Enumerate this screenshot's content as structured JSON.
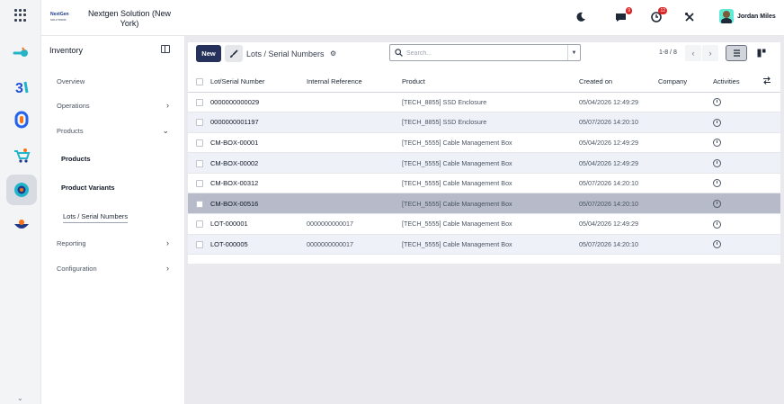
{
  "company": {
    "logo_text": "NextGen",
    "logo_sub": "SOLUTIONS",
    "name": "Nextgen Solution (New York)"
  },
  "header": {
    "chat_badge": "9",
    "activity_badge": "12",
    "user_name": "Jordan Miles"
  },
  "sidebar": {
    "title": "Inventory",
    "items": [
      {
        "label": "Overview"
      },
      {
        "label": "Operations"
      },
      {
        "label": "Products"
      },
      {
        "label": "Reporting"
      },
      {
        "label": "Configuration"
      }
    ],
    "sub_items": [
      {
        "label": "Products"
      },
      {
        "label": "Product Variants"
      },
      {
        "label": "Lots / Serial Numbers"
      }
    ]
  },
  "controls": {
    "new_label": "New",
    "breadcrumb": "Lots / Serial Numbers",
    "search_placeholder": "Search...",
    "pager": "1-8 / 8"
  },
  "table": {
    "headers": [
      "Lot/Serial Number",
      "Internal Reference",
      "Product",
      "Created on",
      "Company",
      "Activities"
    ],
    "rows": [
      {
        "serial": "0000000000029",
        "ref": "",
        "product": "[TECH_8855] SSD Enclosure",
        "created": "05/04/2026 12:49:29",
        "company": ""
      },
      {
        "serial": "0000000001197",
        "ref": "",
        "product": "[TECH_8855] SSD Enclosure",
        "created": "05/07/2026 14:20:10",
        "company": ""
      },
      {
        "serial": "CM-BOX-00001",
        "ref": "",
        "product": "[TECH_5555] Cable Management Box",
        "created": "05/04/2026 12:49:29",
        "company": ""
      },
      {
        "serial": "CM-BOX-00002",
        "ref": "",
        "product": "[TECH_5555] Cable Management Box",
        "created": "05/04/2026 12:49:29",
        "company": ""
      },
      {
        "serial": "CM-BOX-00312",
        "ref": "",
        "product": "[TECH_5555] Cable Management Box",
        "created": "05/07/2026 14:20:10",
        "company": ""
      },
      {
        "serial": "CM-BOX-00516",
        "ref": "",
        "product": "[TECH_5555] Cable Management Box",
        "created": "05/07/2026 14:20:10",
        "company": ""
      },
      {
        "serial": "LOT-000001",
        "ref": "0000000000017",
        "product": "[TECH_5555] Cable Management Box",
        "created": "05/04/2026 12:49:29",
        "company": ""
      },
      {
        "serial": "LOT-000005",
        "ref": "0000000000017",
        "product": "[TECH_5555] Cable Management Box",
        "created": "05/07/2026 14:20:10",
        "company": ""
      }
    ]
  }
}
